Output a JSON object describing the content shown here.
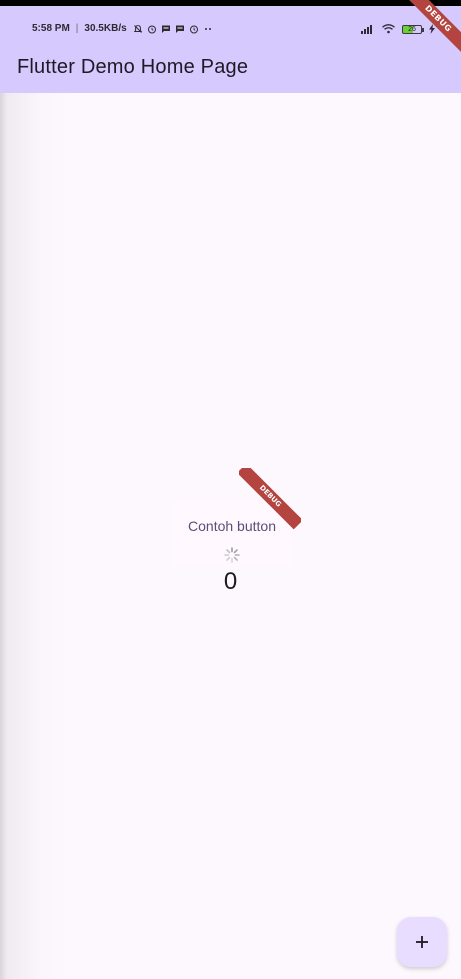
{
  "status_bar": {
    "time": "5:58 PM",
    "network_speed": "30.5KB/s",
    "battery_level": "26",
    "icons": [
      "bell-off-icon",
      "alarm-icon",
      "message-icon",
      "message-icon",
      "alarm-icon",
      "more-dots-icon"
    ],
    "right_icons": [
      "signal-icon",
      "wifi-icon",
      "battery-icon",
      "charging-icon"
    ]
  },
  "app_bar": {
    "title": "Flutter Demo Home Page",
    "background": "#d6c9fd"
  },
  "debug_banner": {
    "label": "DEBUG"
  },
  "main": {
    "button_label": "Contoh button",
    "counter": "0",
    "inner_debug_label": "DEBUG"
  },
  "fab": {
    "icon": "plus-icon",
    "background": "#e8ddff"
  },
  "colors": {
    "page_background": "#fdf7fe",
    "debug_banner": "#b3443f",
    "accent_text": "#5a4f76"
  }
}
